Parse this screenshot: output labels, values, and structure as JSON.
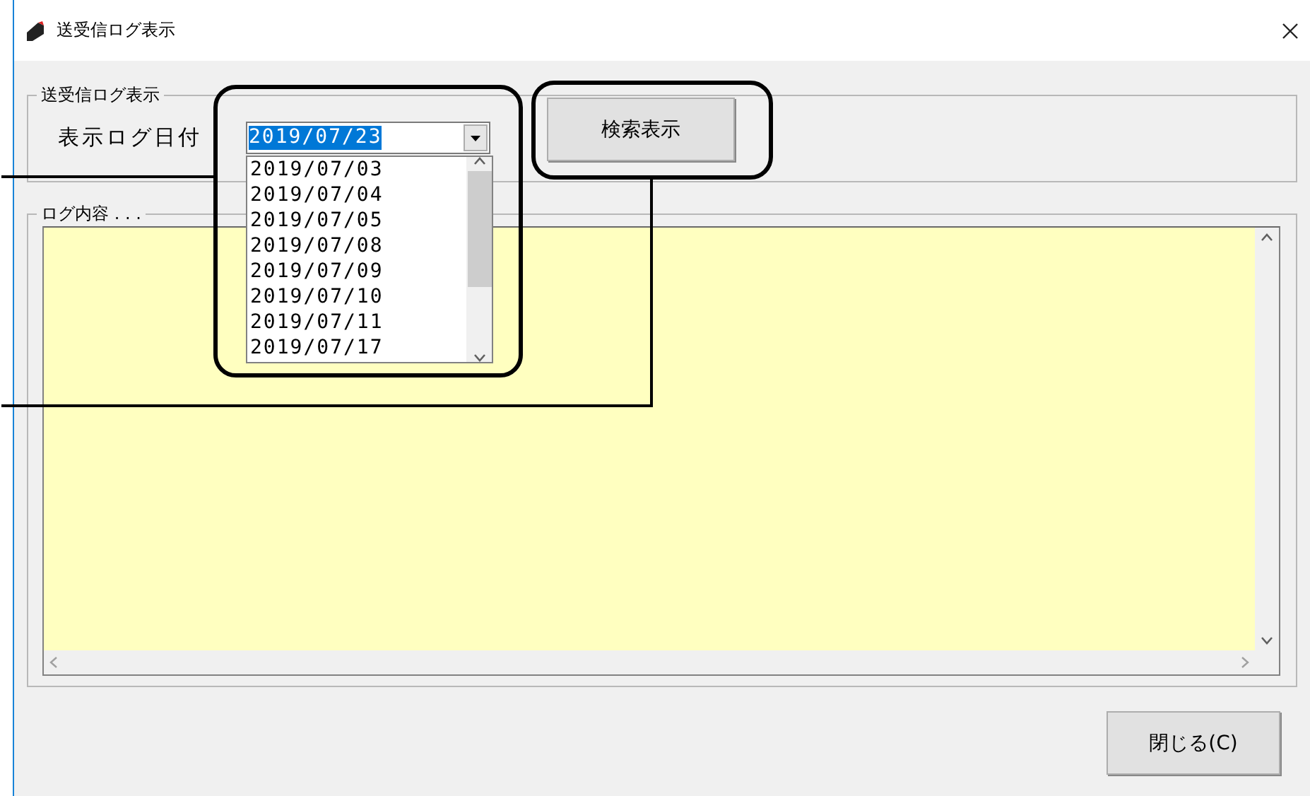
{
  "window": {
    "title": "送受信ログ表示"
  },
  "search_group": {
    "legend": "送受信ログ表示",
    "label": "表示ログ日付",
    "date_combo": {
      "value": "2019/07/23"
    },
    "dropdown_items": [
      "2019/07/03",
      "2019/07/04",
      "2019/07/05",
      "2019/07/08",
      "2019/07/09",
      "2019/07/10",
      "2019/07/11",
      "2019/07/17"
    ],
    "search_button": "検索表示"
  },
  "log_group": {
    "legend": "ログ内容 . . ."
  },
  "close_button": "閉じる(C)"
}
